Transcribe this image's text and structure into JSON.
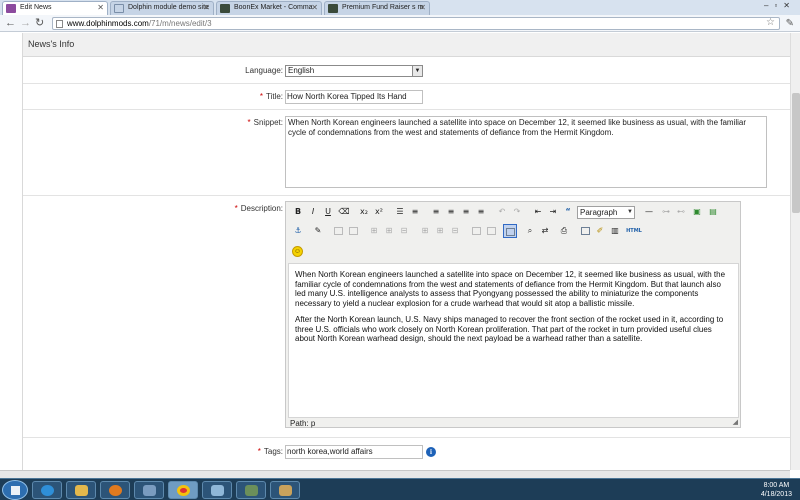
{
  "browser": {
    "tabs": [
      {
        "label": "Edit News",
        "icon": "page-icon",
        "active": true
      },
      {
        "label": "Dolphin module demo site",
        "icon": "globe-icon",
        "active": false
      },
      {
        "label": "BoonEx Market - Comma",
        "icon": "boonex-icon",
        "active": false
      },
      {
        "label": "Premium Fund Raiser s m",
        "icon": "boonex-icon",
        "active": false
      }
    ],
    "url_host": "www.dolphinmods.com",
    "url_path": "/71/m/news/edit/3"
  },
  "form": {
    "section_title": "News's Info",
    "language": {
      "label": "Language:",
      "value": "English"
    },
    "title": {
      "label": "Title:",
      "value": "How North Korea Tipped Its Hand"
    },
    "snippet": {
      "label": "Snippet:",
      "value": "When North Korean engineers launched a satellite into space on December 12, it seemed like business as usual, with the familiar cycle of condemnations from the west and statements of defiance from the Hermit Kingdom."
    },
    "description": {
      "label": "Description:",
      "format": "Paragraph",
      "paragraphs": [
        "When North Korean engineers launched a satellite into space on December 12, it seemed like business as usual, with the familiar cycle of condemnations from the west and statements of defiance from the Hermit Kingdom. But that launch also led many U.S. intelligence analysts to assess that Pyongyang possessed the ability to miniaturize the components necessary to yield a nuclear explosion for a crude warhead that would sit atop a ballistic missile.",
        "After the North Korean launch, U.S. Navy ships managed to recover the front section of the rocket used in it, according to three U.S. officials who work closely on North Korean proliferation. That part of the rocket in turn provided useful clues about North Korean warhead design, should the next payload be a warhead rather than a satellite."
      ],
      "path": "Path: p",
      "html_button": "HTML"
    },
    "tags": {
      "label": "Tags:",
      "value": "north korea,world affairs"
    },
    "required_mark": "*"
  },
  "taskbar": {
    "time": "8:00 AM",
    "date": "4/18/2013"
  }
}
